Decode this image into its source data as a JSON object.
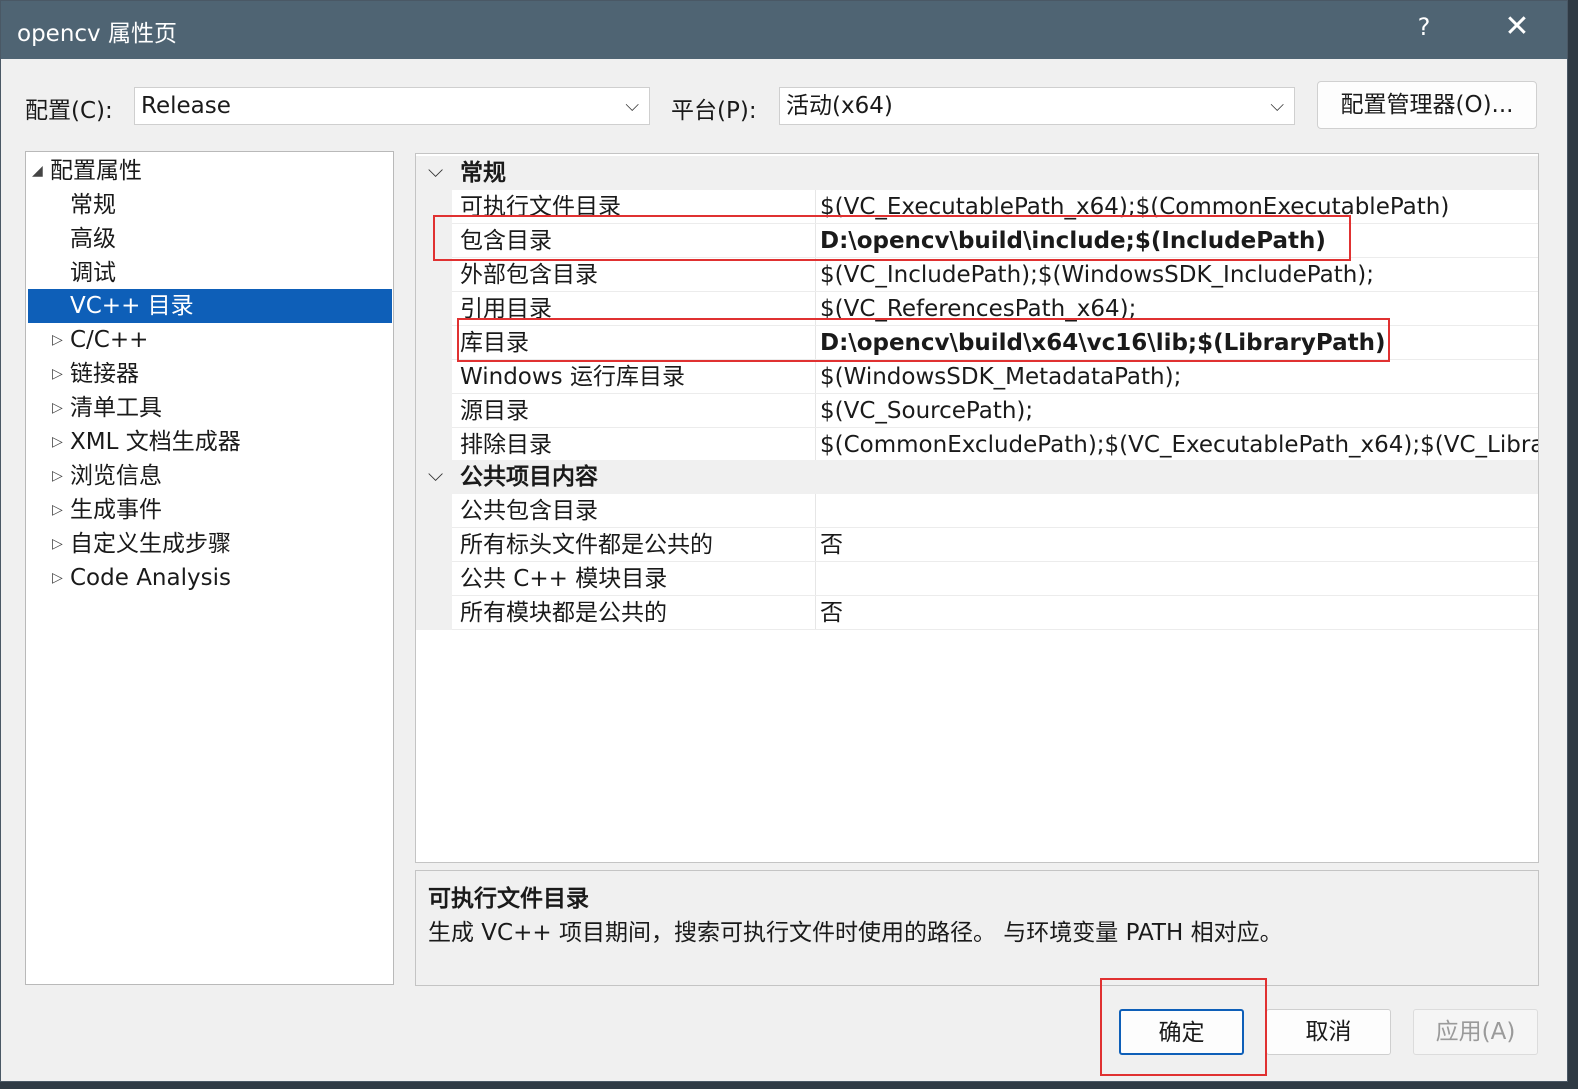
{
  "window": {
    "title": "opencv 属性页",
    "help": "?",
    "close": "✕"
  },
  "config": {
    "config_label": "配置(C):",
    "config_value": "Release",
    "platform_label": "平台(P):",
    "platform_value": "活动(x64)",
    "manager_button": "配置管理器(O)..."
  },
  "tree": {
    "root": "配置属性",
    "children": [
      "常规",
      "高级",
      "调试",
      "VC++ 目录"
    ],
    "collapsed": [
      "C/C++",
      "链接器",
      "清单工具",
      "XML 文档生成器",
      "浏览信息",
      "生成事件",
      "自定义生成步骤",
      "Code Analysis"
    ]
  },
  "grid": {
    "cat1": "常规",
    "rows1": [
      {
        "name": "可执行文件目录",
        "value": "$(VC_ExecutablePath_x64);$(CommonExecutablePath)"
      },
      {
        "name": "包含目录",
        "value": "D:\\opencv\\build\\include;$(IncludePath)"
      },
      {
        "name": "外部包含目录",
        "value": "$(VC_IncludePath);$(WindowsSDK_IncludePath);"
      },
      {
        "name": "引用目录",
        "value": "$(VC_ReferencesPath_x64);"
      },
      {
        "name": "库目录",
        "value": "D:\\opencv\\build\\x64\\vc16\\lib;$(LibraryPath)"
      },
      {
        "name": "Windows 运行库目录",
        "value": "$(WindowsSDK_MetadataPath);"
      },
      {
        "name": "源目录",
        "value": "$(VC_SourcePath);"
      },
      {
        "name": "排除目录",
        "value": "$(CommonExcludePath);$(VC_ExecutablePath_x64);$(VC_Library"
      }
    ],
    "cat2": "公共项目内容",
    "rows2": [
      {
        "name": "公共包含目录",
        "value": ""
      },
      {
        "name": "所有标头文件都是公共的",
        "value": "否"
      },
      {
        "name": "公共 C++ 模块目录",
        "value": ""
      },
      {
        "name": "所有模块都是公共的",
        "value": "否"
      }
    ]
  },
  "description": {
    "title": "可执行文件目录",
    "text": "生成 VC++ 项目期间，搜索可执行文件时使用的路径。 与环境变量 PATH 相对应。"
  },
  "buttons": {
    "ok": "确定",
    "cancel": "取消",
    "apply": "应用(A)"
  },
  "colors": {
    "title_bar": "#4f6473",
    "selection": "#0e5fb8",
    "highlight_box": "#e03131"
  }
}
